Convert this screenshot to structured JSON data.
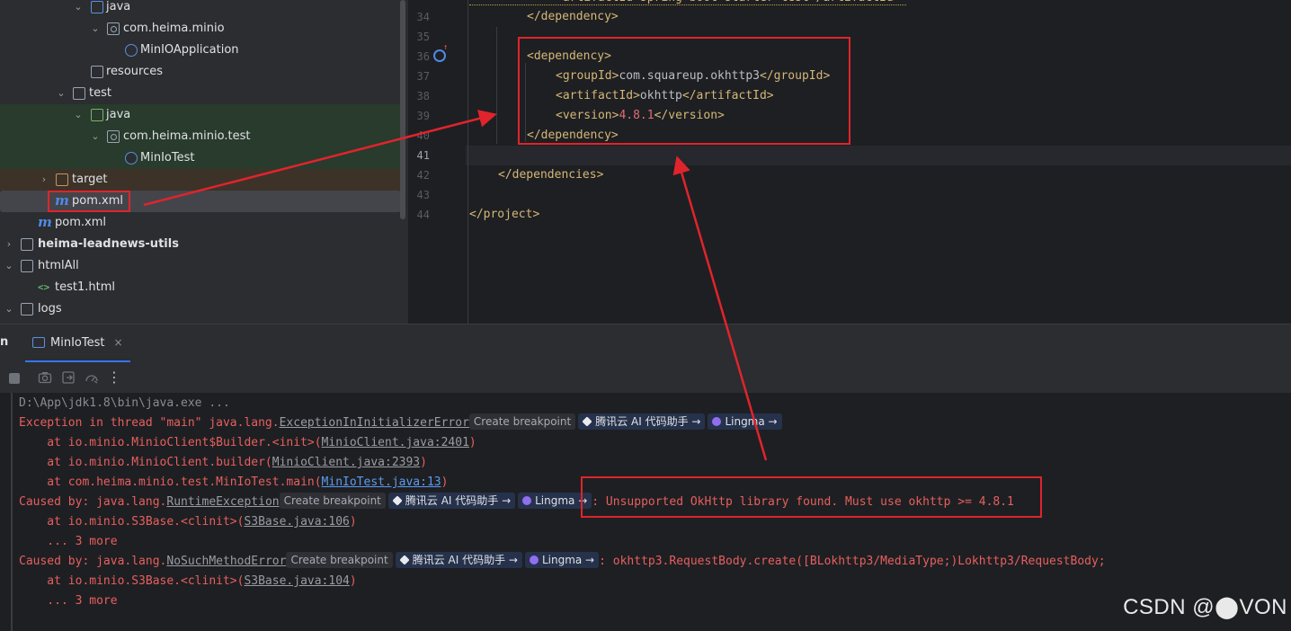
{
  "tree": {
    "items": [
      {
        "label": "java"
      },
      {
        "label": "com.heima.minio"
      },
      {
        "label": "MinIOApplication"
      },
      {
        "label": "resources"
      },
      {
        "label": "test"
      },
      {
        "label": "java"
      },
      {
        "label": "com.heima.minio.test"
      },
      {
        "label": "MinIoTest"
      },
      {
        "label": "target"
      },
      {
        "label": "pom.xml"
      },
      {
        "label": "pom.xml"
      },
      {
        "label": "heima-leadnews-utils"
      },
      {
        "label": "htmlAll"
      },
      {
        "label": "test1.html"
      },
      {
        "label": "logs"
      }
    ]
  },
  "editor": {
    "lines": [
      {
        "num": "34"
      },
      {
        "num": "35"
      },
      {
        "num": "36"
      },
      {
        "num": "37"
      },
      {
        "num": "38"
      },
      {
        "num": "39"
      },
      {
        "num": "40"
      },
      {
        "num": "41"
      },
      {
        "num": "42"
      },
      {
        "num": "43"
      },
      {
        "num": "44"
      }
    ],
    "top_partial": "<artifactId>spring-boot-starter-test</artifactId>",
    "line34": "</dependency>",
    "line36": "<dependency>",
    "groupId_open": "<groupId>",
    "groupId_val": "com.squareup.okhttp3",
    "groupId_close": "</groupId>",
    "artifactId_open": "<artifactId>",
    "artifactId_val": "okhttp",
    "artifactId_close": "</artifactId>",
    "version_open": "<version>",
    "version_val": "4.8.1",
    "version_close": "</version>",
    "line40": "</dependency>",
    "line42": "</dependencies>",
    "line44": "</project>"
  },
  "run": {
    "label": "n",
    "tab_label": "MinIoTest",
    "tab_close": "×",
    "toolbar_more": "⋮"
  },
  "console": {
    "l1": "D:\\App\\jdk1.8\\bin\\java.exe ...",
    "l2_prefix": "Exception in thread \"main\" java.lang.",
    "l2_exc": "ExceptionInInitializerError",
    "l3_prefix": "    at io.minio.MinioClient$Builder.<init>(",
    "l3_link": "MinioClient.java:2401",
    "l3_suffix": ")",
    "l4_prefix": "    at io.minio.MinioClient.builder(",
    "l4_link": "MinioClient.java:2393",
    "l4_suffix": ")",
    "l5_prefix": "    at com.heima.minio.test.MinIoTest.main(",
    "l5_link": "MinIoTest.java:13",
    "l5_suffix": ")",
    "l6_prefix": "Caused by: java.lang.",
    "l6_exc": "RuntimeException",
    "l6_msg": ": Unsupported OkHttp library found. Must use okhttp >= 4.8.1",
    "l7_prefix": "    at io.minio.S3Base.<clinit>(",
    "l7_link": "S3Base.java:106",
    "l7_suffix": ")",
    "l8": "    ... 3 more",
    "l9_prefix": "Caused by: java.lang.",
    "l9_exc": "NoSuchMethodError",
    "l9_msg": ": okhttp3.RequestBody.create([BLokhttp3/MediaType;)Lokhttp3/RequestBody;",
    "l10_prefix": "    at io.minio.S3Base.<clinit>(",
    "l10_link": "S3Base.java:104",
    "l10_suffix": ")",
    "l11": "    ... 3 more",
    "chip_breakpoint": "Create breakpoint",
    "chip_tencent": "腾讯云 AI 代码助手 →",
    "chip_lingma": "Lingma →"
  },
  "watermark": "CSDN @⬤VON",
  "colors": {
    "annotation_red": "#e0242c",
    "error_red": "#e75f5f",
    "tag_yellow": "#d5b778"
  }
}
